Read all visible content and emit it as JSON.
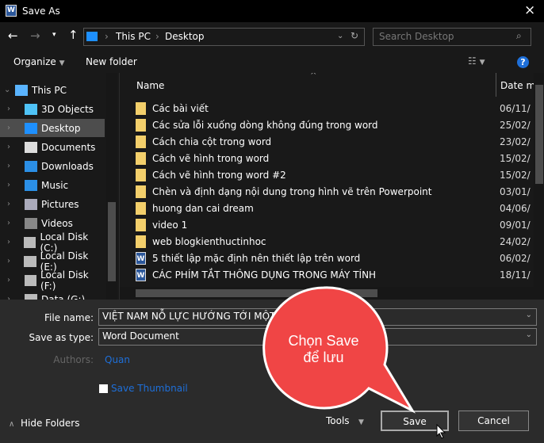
{
  "window": {
    "title": "Save As",
    "app_icon": "word-icon",
    "close": "×"
  },
  "nav": {
    "breadcrumb": [
      "This PC",
      "Desktop"
    ],
    "search_placeholder": "Search Desktop"
  },
  "toolbar": {
    "organize": "Organize",
    "new_folder": "New folder",
    "help": "?"
  },
  "sidebar": {
    "items": [
      {
        "label": "This PC",
        "icon": "computer-icon"
      },
      {
        "label": "3D Objects",
        "icon": "cube-icon"
      },
      {
        "label": "Desktop",
        "icon": "desktop-icon",
        "selected": true
      },
      {
        "label": "Documents",
        "icon": "document-icon"
      },
      {
        "label": "Downloads",
        "icon": "download-icon"
      },
      {
        "label": "Music",
        "icon": "music-icon"
      },
      {
        "label": "Pictures",
        "icon": "picture-icon"
      },
      {
        "label": "Videos",
        "icon": "video-icon"
      },
      {
        "label": "Local Disk (C:)",
        "icon": "drive-icon"
      },
      {
        "label": "Local Disk (E:)",
        "icon": "drive-icon"
      },
      {
        "label": "Local Disk (F:)",
        "icon": "drive-icon"
      },
      {
        "label": "Data (G:)",
        "icon": "drive-icon"
      }
    ]
  },
  "columns": {
    "name": "Name",
    "date": "Date m"
  },
  "files": [
    {
      "name": "Các bài viết",
      "date": "06/11/",
      "type": "folder"
    },
    {
      "name": "Các sửa lỗi xuống dòng không đúng trong word",
      "date": "25/02/",
      "type": "folder"
    },
    {
      "name": "Cách chia cột trong word",
      "date": "23/02/",
      "type": "folder"
    },
    {
      "name": "Cách vẽ hình trong word",
      "date": "15/02/",
      "type": "folder"
    },
    {
      "name": "Cách vẽ hình trong word #2",
      "date": "15/02/",
      "type": "folder"
    },
    {
      "name": "Chèn và định dạng nội dung trong hình vẽ trên Powerpoint",
      "date": "03/01/",
      "type": "folder"
    },
    {
      "name": "huong dan cai dream",
      "date": "04/06/",
      "type": "folder"
    },
    {
      "name": "video 1",
      "date": "09/01/",
      "type": "folder"
    },
    {
      "name": "web blogkienthuctinhoc",
      "date": "24/02/",
      "type": "folder"
    },
    {
      "name": "5 thiết lập mặc định nên thiết lập trên word",
      "date": "06/02/",
      "type": "word"
    },
    {
      "name": "CÁC PHÍM TẮT THÔNG DỤNG TRONG MÁY TÍNH",
      "date": "18/11/",
      "type": "word"
    }
  ],
  "form": {
    "file_name_label": "File name:",
    "file_name_value": "VIỆT NAM NỖ LỰC HƯỚNG TỚI MỘT ASEAN",
    "save_type_label": "Save as type:",
    "save_type_value": "Word Document",
    "authors_label": "Authors:",
    "authors_value": "Quan",
    "thumbnail_label": "Save Thumbnail",
    "thumbnail_checked": false
  },
  "footer": {
    "hide_folders": "Hide Folders",
    "tools": "Tools",
    "save": "Save",
    "cancel": "Cancel"
  },
  "callout": {
    "line1": "Chọn Save",
    "line2": "để lưu",
    "color": "#f04545"
  }
}
